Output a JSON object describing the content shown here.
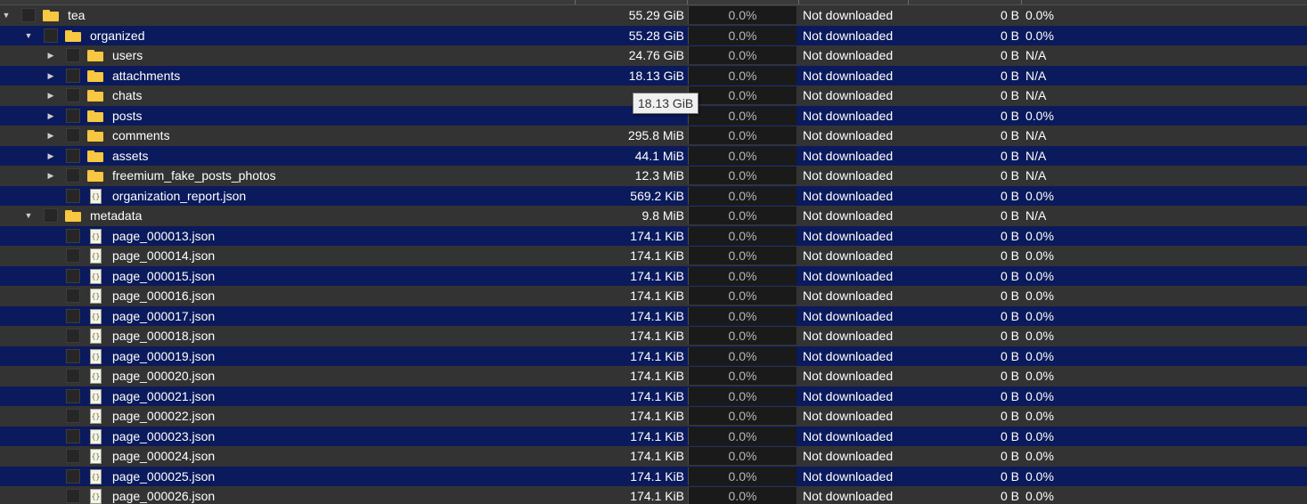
{
  "colors": {
    "row_odd": "#333333",
    "row_even": "#0a1a5c",
    "folder": "#f8c842",
    "text": "#ffffff",
    "progress_text": "#b8b8b8"
  },
  "tooltip": {
    "text": "18.13 GiB"
  },
  "rows": [
    {
      "level": 0,
      "type": "folder",
      "expander": "expanded",
      "name": "tea",
      "size": "55.29 GiB",
      "progress": "0.0%",
      "status": "Not downloaded",
      "remaining": "0 B",
      "availability": "0.0%"
    },
    {
      "level": 1,
      "type": "folder",
      "expander": "expanded",
      "name": "organized",
      "size": "55.28 GiB",
      "progress": "0.0%",
      "status": "Not downloaded",
      "remaining": "0 B",
      "availability": "0.0%"
    },
    {
      "level": 2,
      "type": "folder",
      "expander": "collapsed",
      "name": "users",
      "size": "24.76 GiB",
      "progress": "0.0%",
      "status": "Not downloaded",
      "remaining": "0 B",
      "availability": "N/A"
    },
    {
      "level": 2,
      "type": "folder",
      "expander": "collapsed",
      "name": "attachments",
      "size": "18.13 GiB",
      "progress": "0.0%",
      "status": "Not downloaded",
      "remaining": "0 B",
      "availability": "N/A"
    },
    {
      "level": 2,
      "type": "folder",
      "expander": "collapsed",
      "name": "chats",
      "size": "",
      "progress": "0.0%",
      "status": "Not downloaded",
      "remaining": "0 B",
      "availability": "N/A"
    },
    {
      "level": 2,
      "type": "folder",
      "expander": "collapsed",
      "name": "posts",
      "size": "",
      "progress": "0.0%",
      "status": "Not downloaded",
      "remaining": "0 B",
      "availability": "0.0%"
    },
    {
      "level": 2,
      "type": "folder",
      "expander": "collapsed",
      "name": "comments",
      "size": "295.8 MiB",
      "progress": "0.0%",
      "status": "Not downloaded",
      "remaining": "0 B",
      "availability": "N/A"
    },
    {
      "level": 2,
      "type": "folder",
      "expander": "collapsed",
      "name": "assets",
      "size": "44.1 MiB",
      "progress": "0.0%",
      "status": "Not downloaded",
      "remaining": "0 B",
      "availability": "N/A"
    },
    {
      "level": 2,
      "type": "folder",
      "expander": "collapsed",
      "name": "freemium_fake_posts_photos",
      "size": "12.3 MiB",
      "progress": "0.0%",
      "status": "Not downloaded",
      "remaining": "0 B",
      "availability": "N/A"
    },
    {
      "level": 2,
      "type": "file",
      "expander": "none",
      "name": "organization_report.json",
      "size": "569.2 KiB",
      "progress": "0.0%",
      "status": "Not downloaded",
      "remaining": "0 B",
      "availability": "0.0%"
    },
    {
      "level": 1,
      "type": "folder",
      "expander": "expanded",
      "name": "metadata",
      "size": "9.8 MiB",
      "progress": "0.0%",
      "status": "Not downloaded",
      "remaining": "0 B",
      "availability": "N/A"
    },
    {
      "level": 2,
      "type": "file",
      "expander": "none",
      "name": "page_000013.json",
      "size": "174.1 KiB",
      "progress": "0.0%",
      "status": "Not downloaded",
      "remaining": "0 B",
      "availability": "0.0%"
    },
    {
      "level": 2,
      "type": "file",
      "expander": "none",
      "name": "page_000014.json",
      "size": "174.1 KiB",
      "progress": "0.0%",
      "status": "Not downloaded",
      "remaining": "0 B",
      "availability": "0.0%"
    },
    {
      "level": 2,
      "type": "file",
      "expander": "none",
      "name": "page_000015.json",
      "size": "174.1 KiB",
      "progress": "0.0%",
      "status": "Not downloaded",
      "remaining": "0 B",
      "availability": "0.0%"
    },
    {
      "level": 2,
      "type": "file",
      "expander": "none",
      "name": "page_000016.json",
      "size": "174.1 KiB",
      "progress": "0.0%",
      "status": "Not downloaded",
      "remaining": "0 B",
      "availability": "0.0%"
    },
    {
      "level": 2,
      "type": "file",
      "expander": "none",
      "name": "page_000017.json",
      "size": "174.1 KiB",
      "progress": "0.0%",
      "status": "Not downloaded",
      "remaining": "0 B",
      "availability": "0.0%"
    },
    {
      "level": 2,
      "type": "file",
      "expander": "none",
      "name": "page_000018.json",
      "size": "174.1 KiB",
      "progress": "0.0%",
      "status": "Not downloaded",
      "remaining": "0 B",
      "availability": "0.0%"
    },
    {
      "level": 2,
      "type": "file",
      "expander": "none",
      "name": "page_000019.json",
      "size": "174.1 KiB",
      "progress": "0.0%",
      "status": "Not downloaded",
      "remaining": "0 B",
      "availability": "0.0%"
    },
    {
      "level": 2,
      "type": "file",
      "expander": "none",
      "name": "page_000020.json",
      "size": "174.1 KiB",
      "progress": "0.0%",
      "status": "Not downloaded",
      "remaining": "0 B",
      "availability": "0.0%"
    },
    {
      "level": 2,
      "type": "file",
      "expander": "none",
      "name": "page_000021.json",
      "size": "174.1 KiB",
      "progress": "0.0%",
      "status": "Not downloaded",
      "remaining": "0 B",
      "availability": "0.0%"
    },
    {
      "level": 2,
      "type": "file",
      "expander": "none",
      "name": "page_000022.json",
      "size": "174.1 KiB",
      "progress": "0.0%",
      "status": "Not downloaded",
      "remaining": "0 B",
      "availability": "0.0%"
    },
    {
      "level": 2,
      "type": "file",
      "expander": "none",
      "name": "page_000023.json",
      "size": "174.1 KiB",
      "progress": "0.0%",
      "status": "Not downloaded",
      "remaining": "0 B",
      "availability": "0.0%"
    },
    {
      "level": 2,
      "type": "file",
      "expander": "none",
      "name": "page_000024.json",
      "size": "174.1 KiB",
      "progress": "0.0%",
      "status": "Not downloaded",
      "remaining": "0 B",
      "availability": "0.0%"
    },
    {
      "level": 2,
      "type": "file",
      "expander": "none",
      "name": "page_000025.json",
      "size": "174.1 KiB",
      "progress": "0.0%",
      "status": "Not downloaded",
      "remaining": "0 B",
      "availability": "0.0%"
    },
    {
      "level": 2,
      "type": "file",
      "expander": "none",
      "name": "page_000026.json",
      "size": "174.1 KiB",
      "progress": "0.0%",
      "status": "Not downloaded",
      "remaining": "0 B",
      "availability": "0.0%"
    }
  ]
}
